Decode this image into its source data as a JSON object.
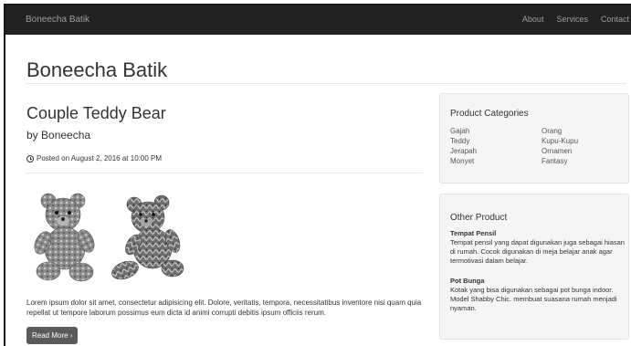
{
  "navbar": {
    "brand": "Boneecha Batik",
    "links": [
      "About",
      "Services",
      "Contact"
    ]
  },
  "header": {
    "site_title": "Boneecha Batik"
  },
  "post": {
    "title": "Couple Teddy Bear",
    "by_label": "by",
    "author": "Boneecha",
    "posted": "Posted on August 2, 2016 at 10:00 PM",
    "excerpt": "Lorem ipsum dolor sit amet, consectetur adipisicing elit. Dolore, veritatis, tempora, necessitatibus inventore nisi quam quia repellat ut tempore laborum possimus eum dicta id animi corrupti debitis ipsum officiis rerum.",
    "read_more": "Read More ›",
    "image_icon": "teddy-bear-pair"
  },
  "sidebar": {
    "categories": {
      "title": "Product Categories",
      "left": [
        "Gajah",
        "Teddy",
        "Jerapah",
        "Monyet"
      ],
      "right": [
        "Orang",
        "Kupu-Kupu",
        "Ornamen",
        "Fantasy"
      ]
    },
    "other": {
      "title": "Other Product",
      "products": [
        {
          "name": "Tempat Pensil",
          "desc": "Tempat pensil yang dapat digunakan juga sebagai hiasan di rumah. Cocok digunakan di meja belajar anak agar termotivasi dalam belajar."
        },
        {
          "name": "Pot Bunga",
          "desc": "Kotak yang bisa digunakan sebagai pot bunga indoor. Model Shabby Chic. membuat suasana rumah menjadi nyaman."
        }
      ]
    }
  },
  "colors": {
    "navbar_bg": "#222222",
    "nav_text": "#9d9d9d",
    "button_bg": "#5a5a5a",
    "widget_bg": "#f5f5f5"
  }
}
